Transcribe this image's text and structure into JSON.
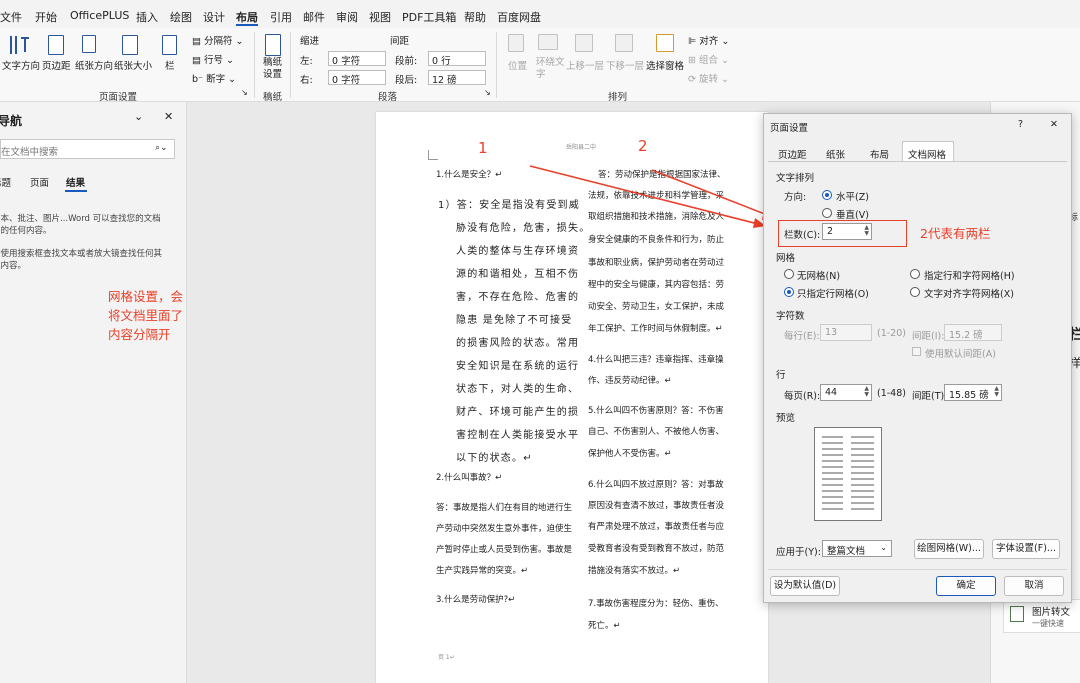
{
  "menu": {
    "file": "文件",
    "home": "开始",
    "officeplus": "OfficePLUS",
    "insert": "插入",
    "draw": "绘图",
    "design": "设计",
    "layout": "布局",
    "references": "引用",
    "mailings": "邮件",
    "review": "审阅",
    "view": "视图",
    "pdf": "PDF工具箱",
    "help": "帮助",
    "baidu": "百度网盘"
  },
  "ribbon": {
    "text_direction": "文字方向",
    "margins": "页边距",
    "orientation": "纸张方向",
    "size": "纸张大小",
    "columns": "栏",
    "breaks": "分隔符",
    "line_numbers": "行号",
    "hyphenation": "断字",
    "page_setup_group": "页面设置",
    "draft_paper": "稿纸\n设置",
    "draft_group": "稿纸",
    "indent": "缩进",
    "spacing": "间距",
    "left_label": "左:",
    "left_val": "0 字符",
    "right_label": "右:",
    "right_val": "0 字符",
    "before_label": "段前:",
    "before_val": "0 行",
    "after_label": "段后:",
    "after_val": "12 磅",
    "paragraph_group": "段落",
    "position": "位置",
    "wrap_text": "环绕文\n字",
    "bring_forward": "上移一层",
    "send_backward": "下移一层",
    "selection_pane": "选择窗格",
    "align": "对齐",
    "group": "组合",
    "rotate": "旋转",
    "arrange_group": "排列"
  },
  "nav": {
    "title": "导航",
    "search_placeholder": "在文档中搜索",
    "tab_headings": "标题",
    "tab_pages": "页面",
    "tab_results": "结果",
    "hint1a": "文本、批注、图片...Word 可以查找您的文档",
    "hint1b": "中的任何内容。",
    "hint2a": "请使用搜索框查找文本或者放大镜查找任何其",
    "hint2b": "他内容。"
  },
  "annotations": {
    "grid_note": "网格设置，会将文档里面了内容分隔开",
    "col_note": "2代表有两栏",
    "num1": "1",
    "num2": "2"
  },
  "doc": {
    "header": "岳阳县二中",
    "left_col": [
      "1.什么是安全？↵",
      "1）答：安全是指没有受到威",
      "胁没有危险，危害，损失。",
      "人类的整体与生存环境资",
      "源的和谐相处，互相不伤",
      "害，不存在危险、危害的",
      "隐患 是免除了不可接受",
      "的损害风险的状态。常用",
      "安全知识是在系统的运行",
      "状态下，对人类的生命、",
      "财产、环境可能产生的损",
      "害控制在人类能接受水平",
      "以下的状态。↵",
      "2.什么叫事故？↵",
      "答：事故是指人们在有目的地进行生",
      "产劳动中突然发生意外事件，迫使生",
      "产暂时停止或人员受到伤害。事故是",
      "生产实践异常的突变。↵",
      "3.什么是劳动保护?↵"
    ],
    "right_col": [
      "答：劳动保护是指根据国家法律、",
      "法规，依靠技术进步和科学管理，采",
      "取组织措施和技术措施，消除危及人",
      "身安全健康的不良条件和行为，防止",
      "事故和职业病，保护劳动者在劳动过",
      "程中的安全与健康，其内容包括：劳",
      "动安全、劳动卫生，女工保护，未成",
      "年工保护、工作时间与休假制度。↵",
      "4.什么叫把三违？违章指挥、违章操",
      "作、违反劳动纪律。↵",
      "5.什么叫四不伤害原则？答：不伤害",
      "自己、不伤害别人、不被他人伤害、",
      "保护他人不受伤害。↵",
      "6.什么叫四不放过原则？答：对事故",
      "原因没有查清不放过，事故责任者没",
      "有严肃处理不放过，事故责任者与应",
      "受教育者没有受到教育不放过，防范",
      "措施没有落实不放过。↵",
      "7.事故伤害程度分为：轻伤、重伤、",
      "死亡。↵"
    ],
    "footer": "页 1↵"
  },
  "dialog": {
    "title": "页面设置",
    "help": "?",
    "close": "✕",
    "tabs": [
      "页边距",
      "纸张",
      "布局",
      "文档网格"
    ],
    "text_layout": "文字排列",
    "direction": "方向:",
    "horizontal": "水平(Z)",
    "vertical": "垂直(V)",
    "columns_label": "栏数(C):",
    "columns_value": "2",
    "grid": "网格",
    "no_grid": "无网格(N)",
    "specify_line_char": "指定行和字符网格(H)",
    "specify_line": "只指定行网格(O)",
    "snap_char": "文字对齐字符网格(X)",
    "chars": "字符数",
    "per_line": "每行(E):",
    "per_line_val": "13",
    "per_line_range": "(1-20)",
    "pitch": "间距(I):",
    "pitch_val": "15.2 磅",
    "use_default": "使用默认间距(A)",
    "lines": "行",
    "per_page": "每页(R):",
    "per_page_val": "44",
    "per_page_range": "(1-48)",
    "line_pitch": "间距(T):",
    "line_pitch_val": "15.85 磅",
    "preview": "预览",
    "apply_to": "应用于(Y):",
    "apply_val": "整篇文档",
    "draw_grid": "绘图网格(W)...",
    "font_settings": "字体设置(F)...",
    "set_default": "设为默认值(D)",
    "ok": "确定",
    "cancel": "取消"
  },
  "side": {
    "picture_to_text": "图片转文",
    "one_click": "一键快速",
    "partial1": "标",
    "partial2": "栏",
    "partial3": "样",
    "partial4": "标"
  },
  "colors": {
    "accent": "#185abd",
    "annotation": "#e8412a"
  }
}
